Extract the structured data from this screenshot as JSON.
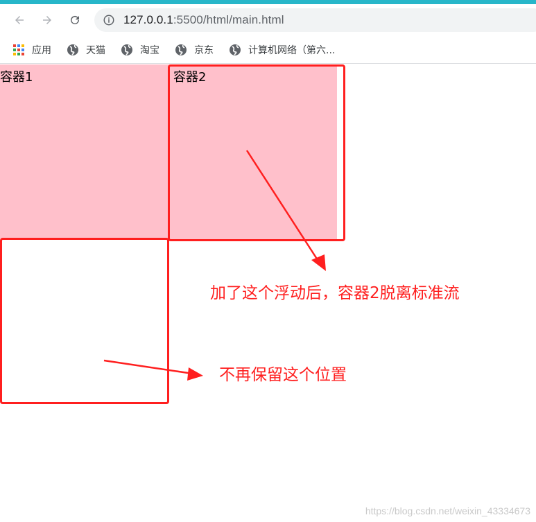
{
  "browser": {
    "url_host": "127.0.0.1",
    "url_rest": ":5500/html/main.html",
    "accent_bar_color": "#27b6c9"
  },
  "bookmarks": [
    {
      "label": "应用",
      "icon": "apps-grid-icon"
    },
    {
      "label": "天猫",
      "icon": "globe-icon"
    },
    {
      "label": "淘宝",
      "icon": "globe-icon"
    },
    {
      "label": "京东",
      "icon": "globe-icon"
    },
    {
      "label": "计算机网络（第六...",
      "icon": "globe-icon"
    }
  ],
  "page": {
    "box1_label": "容器1",
    "box2_label": "容器2",
    "box_color": "#ffc0cb"
  },
  "annotations": {
    "text1": "加了这个浮动后，容器2脱离标准流",
    "text2": "不再保留这个位置",
    "color": "#ff1f1f"
  },
  "watermark": "https://blog.csdn.net/weixin_43334673"
}
